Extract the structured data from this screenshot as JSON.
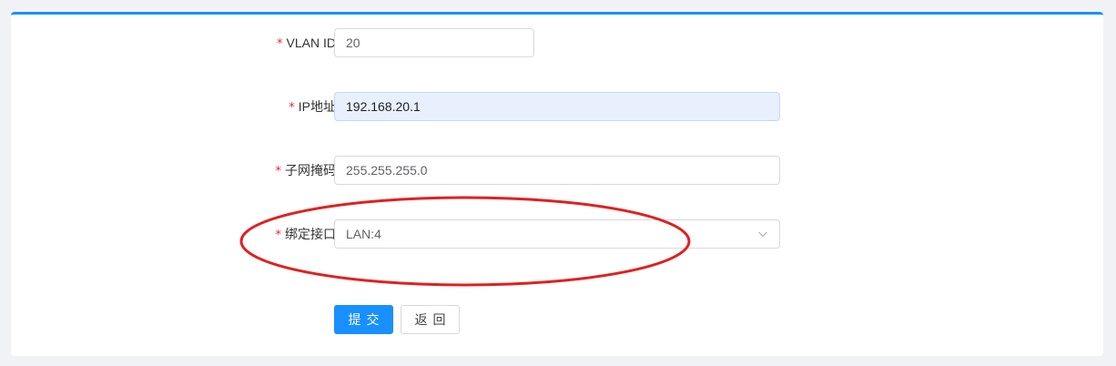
{
  "form": {
    "vlan_id": {
      "required_mark": "*",
      "label": "VLAN ID",
      "value": "20"
    },
    "ip_address": {
      "required_mark": "*",
      "label": "IP地址",
      "value": "192.168.20.1"
    },
    "subnet_mask": {
      "required_mark": "*",
      "label": "子网掩码",
      "value": "255.255.255.0"
    },
    "bind_interface": {
      "required_mark": "*",
      "label": "绑定接口",
      "selected": "LAN:4",
      "icon": "chevron-down-icon"
    }
  },
  "actions": {
    "submit_label": "提交",
    "back_label": "返回"
  },
  "colors": {
    "accent": "#1890ff",
    "required": "#f5222d",
    "annotation": "#e02020",
    "autofill_bg": "#e8f0fe"
  }
}
